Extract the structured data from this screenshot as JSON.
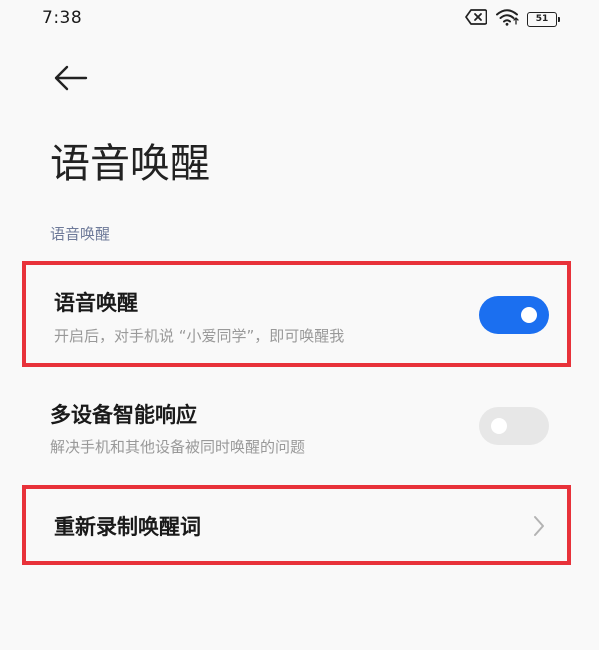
{
  "status_bar": {
    "time": "7:38",
    "battery": "51",
    "icons": [
      "sim-x-icon",
      "wifi-icon",
      "battery-icon"
    ]
  },
  "nav": {
    "back_icon": "arrow-left-icon"
  },
  "page": {
    "title": "语音唤醒"
  },
  "section": {
    "header": "语音唤醒"
  },
  "settings": [
    {
      "title": "语音唤醒",
      "subtitle": "开启后，对手机说 “小爱同学”，即可唤醒我",
      "control": "toggle",
      "enabled": true
    },
    {
      "title": "多设备智能响应",
      "subtitle": "解决手机和其他设备被同时唤醒的问题",
      "control": "toggle",
      "enabled": false
    },
    {
      "title": "重新录制唤醒词",
      "control": "chevron",
      "icon": "chevron-right-icon"
    }
  ],
  "colors": {
    "accent": "#1b6ff0",
    "highlight_border": "#e8323a",
    "toggle_off": "#e7e7e7",
    "section_header": "#6e7a99",
    "background": "#f9f9f9"
  }
}
